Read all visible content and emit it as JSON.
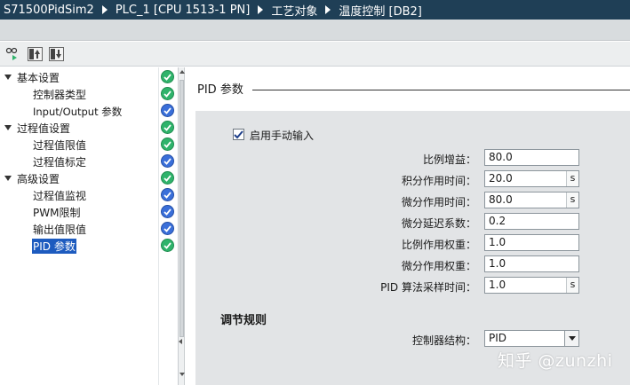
{
  "breadcrumb": [
    "S71500PidSim2",
    "PLC_1 [CPU 1513-1 PN]",
    "工艺对象",
    "温度控制 [DB2]"
  ],
  "toolbar": {
    "buttons": [
      "monitor-toggle-icon",
      "upload-icon",
      "download-icon"
    ]
  },
  "nav": {
    "items": [
      {
        "label": "基本设置",
        "level": 0,
        "expanded": true,
        "status": "ok"
      },
      {
        "label": "控制器类型",
        "level": 1,
        "status": "ok"
      },
      {
        "label": "Input/Output 参数",
        "level": 1,
        "status": "default"
      },
      {
        "label": "过程值设置",
        "level": 0,
        "expanded": true,
        "status": "ok"
      },
      {
        "label": "过程值限值",
        "level": 1,
        "status": "ok"
      },
      {
        "label": "过程值标定",
        "level": 1,
        "status": "default"
      },
      {
        "label": "高级设置",
        "level": 0,
        "expanded": true,
        "status": "ok"
      },
      {
        "label": "过程值监视",
        "level": 1,
        "status": "default"
      },
      {
        "label": "PWM限制",
        "level": 1,
        "status": "default"
      },
      {
        "label": "输出值限值",
        "level": 1,
        "status": "default"
      },
      {
        "label": "PID 参数",
        "level": 1,
        "status": "ok",
        "selected": true
      }
    ]
  },
  "colors": {
    "titlebar": "#1f3f56",
    "status_ok": "#2fb36b",
    "status_default": "#3a6fd9",
    "selection": "#1d5bbf",
    "panel": "#e2e4e6"
  },
  "section": {
    "title": "PID 参数",
    "manual_entry": {
      "label": "启用手动输入",
      "checked": true
    },
    "fields": [
      {
        "label": "比例增益：",
        "value": "80.0",
        "unit": ""
      },
      {
        "label": "积分作用时间：",
        "value": "20.0",
        "unit": "s"
      },
      {
        "label": "微分作用时间：",
        "value": "80.0",
        "unit": "s"
      },
      {
        "label": "微分延迟系数：",
        "value": "0.2",
        "unit": ""
      },
      {
        "label": "比例作用权重：",
        "value": "1.0",
        "unit": ""
      },
      {
        "label": "微分作用权重：",
        "value": "1.0",
        "unit": ""
      },
      {
        "label": "PID 算法采样时间：",
        "value": "1.0",
        "unit": "s"
      }
    ],
    "tuning_rules": {
      "title": "调节规则",
      "controller_structure_label": "控制器结构：",
      "controller_structure_value": "PID"
    }
  },
  "watermark": "知乎 @zunzhi"
}
